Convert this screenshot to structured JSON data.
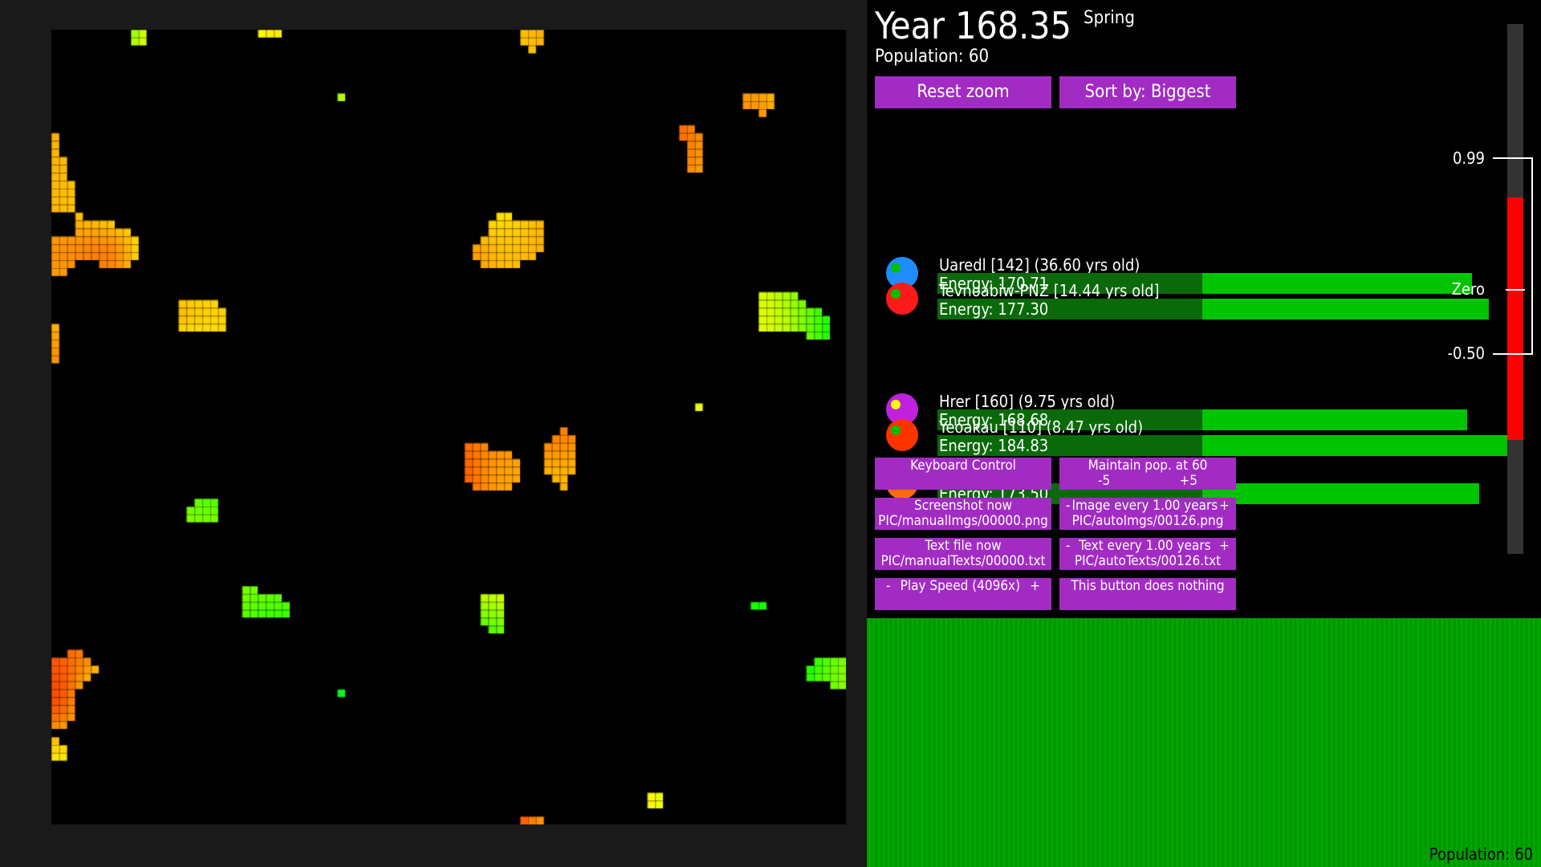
{
  "header": {
    "year": "Year 168.35",
    "season": "Spring",
    "population": "Population: 60"
  },
  "buttons": {
    "reset_zoom": "Reset zoom",
    "sort_by": "Sort by: Biggest",
    "keyboard_control": "Keyboard Control",
    "maintain_pop": "Maintain pop. at 60",
    "maintain_minus": "-5",
    "maintain_plus": "+5",
    "screenshot_now": "Screenshot now",
    "screenshot_path": "PIC/manualImgs/00000.png",
    "image_every": "Image every 1.00 years",
    "image_path": "PIC/autoImgs/00126.png",
    "text_file_now": "Text file now",
    "text_file_path": "PIC/manualTexts/00000.txt",
    "text_every": "Text every 1.00 years",
    "text_path": "PIC/autoTexts/00126.txt",
    "play_speed": "Play Speed (4096x)",
    "nothing": "This button does nothing",
    "minus": "-",
    "plus": "+"
  },
  "creatures": [
    {
      "name": "Uaredl [142] (36.60 yrs old)",
      "energy": "Energy: 170.71",
      "energy_value": 170.71,
      "icon_color": "#1e8cff",
      "dot_color": "#00c000"
    },
    {
      "name": "Tevnoabiw-PNZ [14.44 yrs old]",
      "energy": "Energy: 177.30",
      "energy_value": 177.3,
      "icon_color": "#ff1a1a",
      "dot_color": "#00c000"
    },
    {
      "name": "Hrer [160] (9.75 yrs old)",
      "energy": "Energy: 168.68",
      "energy_value": 168.68,
      "icon_color": "#c020e0",
      "dot_color": "#ffff00"
    },
    {
      "name": "Yeoakau [110] (8.47 yrs old)",
      "energy": "Energy: 184.83",
      "energy_value": 184.83,
      "icon_color": "#ff3300",
      "dot_color": "#00c000"
    },
    {
      "name": "",
      "energy": "Energy: 173.50",
      "energy_value": 173.5,
      "icon_color": "#ff6a00",
      "dot_color": "#ffff00"
    }
  ],
  "scale": {
    "top_label": "0.99",
    "zero_label": "Zero",
    "bottom_label": "-0.50",
    "level": 0.99
  },
  "population_graph": {
    "label": "Population: 60",
    "color": "#00a000"
  }
}
